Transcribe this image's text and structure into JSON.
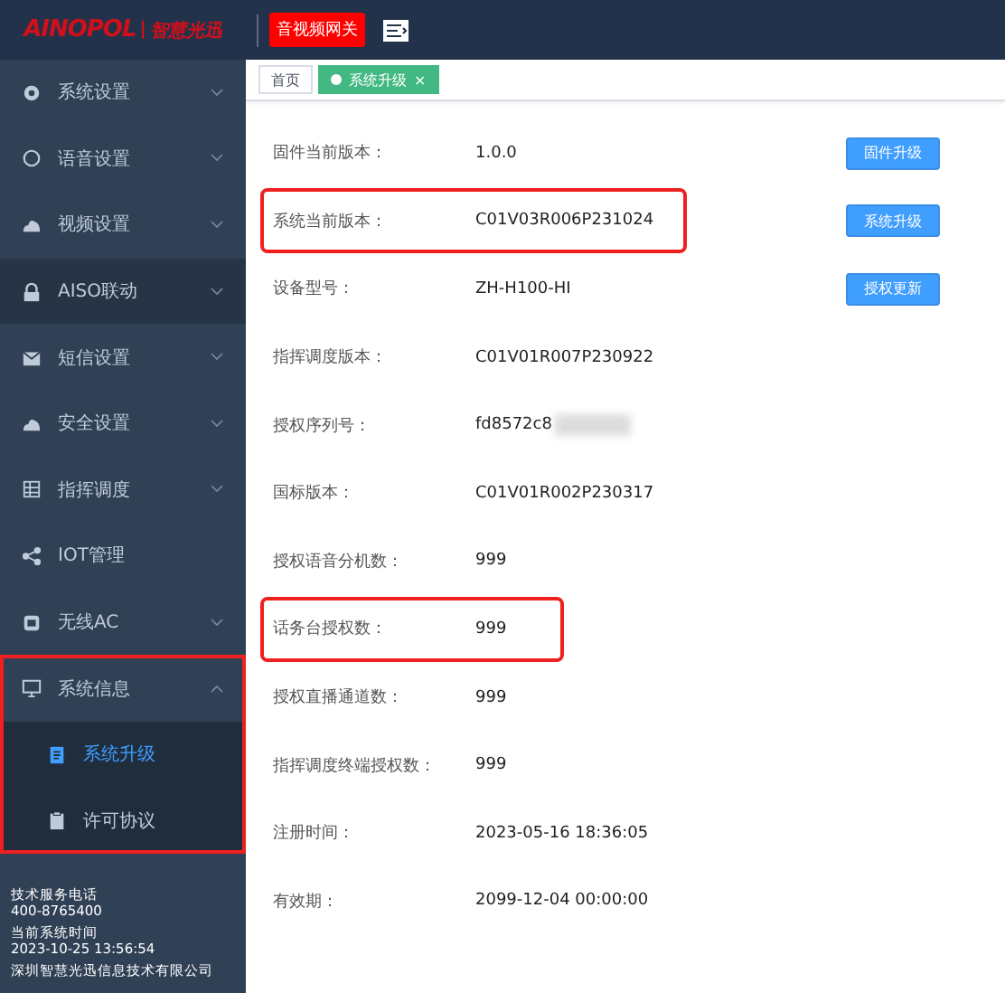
{
  "header": {
    "logo_brand": "AINOPOL",
    "logo_divider": "|",
    "logo_name": "智慧光迅",
    "badge": "音视频网关"
  },
  "sidebar": {
    "items": [
      {
        "label": "系统设置",
        "has_children": true,
        "expanded": false,
        "highlighted": false,
        "annotated": false
      },
      {
        "label": "语音设置",
        "has_children": true,
        "expanded": false,
        "highlighted": false,
        "annotated": false
      },
      {
        "label": "视频设置",
        "has_children": true,
        "expanded": false,
        "highlighted": false,
        "annotated": false
      },
      {
        "label": "AISO联动",
        "has_children": true,
        "expanded": false,
        "highlighted": true,
        "annotated": false
      },
      {
        "label": "短信设置",
        "has_children": true,
        "expanded": false,
        "highlighted": false,
        "annotated": false
      },
      {
        "label": "安全设置",
        "has_children": true,
        "expanded": false,
        "highlighted": false,
        "annotated": false
      },
      {
        "label": "指挥调度",
        "has_children": true,
        "expanded": false,
        "highlighted": false,
        "annotated": false
      },
      {
        "label": "IOT管理",
        "has_children": false,
        "highlighted": false,
        "annotated": false
      },
      {
        "label": "无线AC",
        "has_children": true,
        "expanded": false,
        "highlighted": false,
        "annotated": false
      },
      {
        "label": "系统信息",
        "has_children": true,
        "expanded": true,
        "highlighted": false,
        "annotated": true,
        "children": [
          {
            "label": "系统升级",
            "selected": true
          },
          {
            "label": "许可协议",
            "selected": false
          }
        ]
      }
    ],
    "footer": [
      {
        "label": "技术服务电话",
        "value": "400-8765400"
      },
      {
        "label": "当前系统时间",
        "value": "2023-10-25 13:56:54"
      }
    ],
    "company": "深圳智慧光迅信息技术有限公司"
  },
  "tabs": [
    {
      "label": "首页",
      "selected": false
    },
    {
      "label": "系统升级",
      "selected": true,
      "close": "×"
    }
  ],
  "rows": [
    {
      "label": "固件当前版本：",
      "value": "1.0.0",
      "button": "固件升级",
      "annotated": false
    },
    {
      "label": "系统当前版本：",
      "value": "C01V03R006P231024",
      "button": "系统升级",
      "annotated": true
    },
    {
      "label": "设备型号：",
      "value": "ZH-H100-HI",
      "button": "授权更新",
      "annotated": false
    },
    {
      "label": "指挥调度版本：",
      "value": "C01V01R007P230922",
      "annotated": false
    },
    {
      "label": "授权序列号：",
      "value": "fd8572c8",
      "annotated": false,
      "redacted": true
    },
    {
      "label": "国标版本：",
      "value": "C01V01R002P230317",
      "annotated": false
    },
    {
      "label": "授权语音分机数：",
      "value": "999",
      "annotated": false
    },
    {
      "label": "话务台授权数：",
      "value": "999",
      "annotated": true
    },
    {
      "label": "授权直播通道数：",
      "value": "999",
      "annotated": false
    },
    {
      "label": "指挥调度终端授权数：",
      "value": "999",
      "annotated": false
    },
    {
      "label": "注册时间：",
      "value": "2023-05-16 18:36:05",
      "annotated": false
    },
    {
      "label": "有效期：",
      "value": "2099-12-04 00:00:00",
      "annotated": false
    }
  ]
}
